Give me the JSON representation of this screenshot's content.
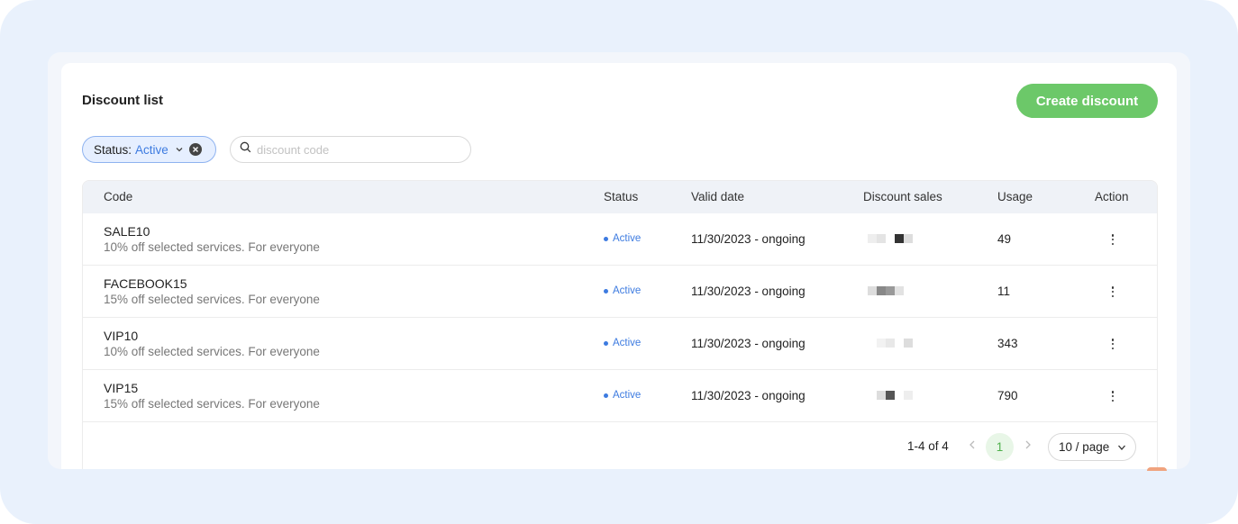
{
  "page": {
    "title": "Discount list",
    "create_button": "Create discount"
  },
  "filters": {
    "status_label": "Status:",
    "status_value": "Active",
    "search_placeholder": "discount code",
    "search_value": ""
  },
  "table": {
    "columns": [
      "Code",
      "Status",
      "Valid date",
      "Discount sales",
      "Usage",
      "Action"
    ],
    "rows": [
      {
        "code": "SALE10",
        "description": "10% off selected services. For everyone",
        "status": "Active",
        "valid_date": "11/30/2023 - ongoing",
        "usage": "49"
      },
      {
        "code": "FACEBOOK15",
        "description": "15% off selected services. For everyone",
        "status": "Active",
        "valid_date": "11/30/2023 - ongoing",
        "usage": "11"
      },
      {
        "code": "VIP10",
        "description": "10% off selected services. For everyone",
        "status": "Active",
        "valid_date": "11/30/2023 - ongoing",
        "usage": "343"
      },
      {
        "code": "VIP15",
        "description": "15% off selected services. For everyone",
        "status": "Active",
        "valid_date": "11/30/2023 - ongoing",
        "usage": "790"
      }
    ]
  },
  "pagination": {
    "range": "1-4 of 4",
    "current_page": "1",
    "page_size": "10 / page"
  },
  "colors": {
    "accent_green": "#6cc869",
    "status_blue": "#3d7be0",
    "frame_bg": "#e9f1fc"
  },
  "icons": [
    "chevron-down-icon",
    "clear-icon",
    "search-icon",
    "more-vertical-icon",
    "chevron-left-icon",
    "chevron-right-icon"
  ]
}
